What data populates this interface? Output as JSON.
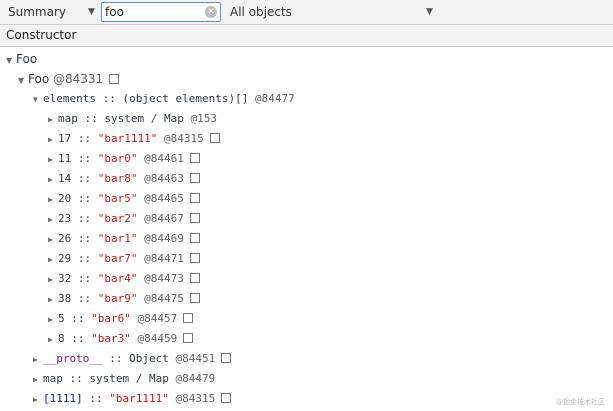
{
  "toolbar": {
    "view_select": "Summary",
    "search_value": "foo",
    "filter_select": "All objects"
  },
  "columns": {
    "constructor": "Constructor"
  },
  "tree": {
    "root": "Foo",
    "foo_node": {
      "name": "Foo",
      "id": "@84331"
    },
    "elements": {
      "name": "elements",
      "sep": " :: ",
      "type": "(object elements)[]",
      "id": "@84477"
    },
    "elements_children": [
      {
        "key": "map",
        "sep": " :: ",
        "value": "system / Map",
        "id": "@153",
        "is_string": false
      },
      {
        "key": "17",
        "sep": " :: ",
        "value": "\"bar1111\"",
        "id": "@84315",
        "is_string": true
      },
      {
        "key": "11",
        "sep": " :: ",
        "value": "\"bar0\"",
        "id": "@84461",
        "is_string": true
      },
      {
        "key": "14",
        "sep": " :: ",
        "value": "\"bar8\"",
        "id": "@84463",
        "is_string": true
      },
      {
        "key": "20",
        "sep": " :: ",
        "value": "\"bar5\"",
        "id": "@84465",
        "is_string": true
      },
      {
        "key": "23",
        "sep": " :: ",
        "value": "\"bar2\"",
        "id": "@84467",
        "is_string": true
      },
      {
        "key": "26",
        "sep": " :: ",
        "value": "\"bar1\"",
        "id": "@84469",
        "is_string": true
      },
      {
        "key": "29",
        "sep": " :: ",
        "value": "\"bar7\"",
        "id": "@84471",
        "is_string": true
      },
      {
        "key": "32",
        "sep": " :: ",
        "value": "\"bar4\"",
        "id": "@84473",
        "is_string": true
      },
      {
        "key": "38",
        "sep": " :: ",
        "value": "\"bar9\"",
        "id": "@84475",
        "is_string": true
      },
      {
        "key": "5",
        "sep": " :: ",
        "value": "\"bar6\"",
        "id": "@84457",
        "is_string": true
      },
      {
        "key": "8",
        "sep": " :: ",
        "value": "\"bar3\"",
        "id": "@84459",
        "is_string": true
      }
    ],
    "foo_children": [
      {
        "key": "__proto__",
        "sep": " :: ",
        "value": "Object",
        "id": "@84451",
        "kind": "proto"
      },
      {
        "key": "map",
        "sep": " :: ",
        "value": "system / Map",
        "id": "@84479",
        "kind": "plain"
      },
      {
        "key": "[1111]",
        "sep": " :: ",
        "value": "\"bar1111\"",
        "id": "@84315",
        "kind": "index"
      }
    ]
  },
  "watermark": "@掘金技术社区",
  "colors": {
    "string": "#c41a16",
    "proto": "#881391",
    "index": "#1a1aa6",
    "focus": "#4d90fe"
  }
}
